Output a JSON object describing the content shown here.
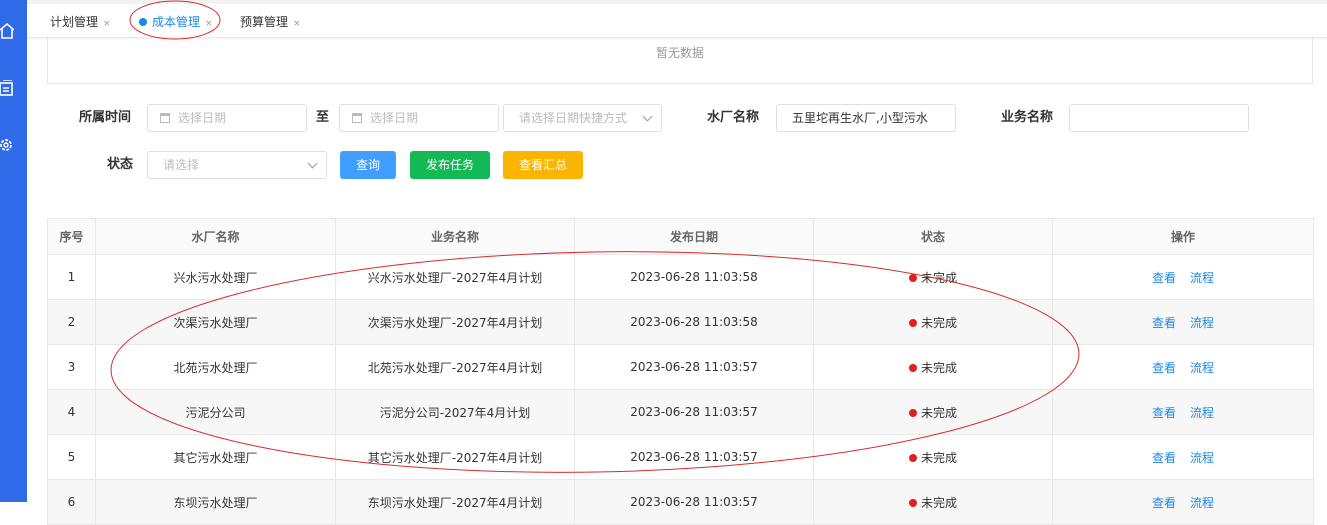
{
  "tabs": [
    {
      "label": "计划管理",
      "active": false
    },
    {
      "label": "成本管理",
      "active": true
    },
    {
      "label": "预算管理",
      "active": false
    }
  ],
  "tab_close_glyph": "×",
  "empty_text": "暂无数据",
  "filters": {
    "time_label": "所属时间",
    "date_start_placeholder": "选择日期",
    "range_sep": "至",
    "date_end_placeholder": "选择日期",
    "quick_placeholder": "请选择日期快捷方式",
    "plant_label": "水厂名称",
    "plant_value": "五里坨再生水厂,小型污水",
    "business_label": "业务名称",
    "business_value": "",
    "status_label": "状态",
    "status_placeholder": "请选择"
  },
  "buttons": {
    "query": "查询",
    "publish": "发布任务",
    "summary": "查看汇总"
  },
  "colors": {
    "sidebar": "#2f6be8",
    "active_tab": "#1e88e5",
    "query_button": "#409eff",
    "publish_button": "#13b955",
    "summary_button": "#fbb400",
    "status_dot": "#e02020",
    "annotation": "#d62b2b"
  },
  "table": {
    "headers": [
      "序号",
      "水厂名称",
      "业务名称",
      "发布日期",
      "状态",
      "操作"
    ],
    "rows": [
      {
        "no": "1",
        "plant": "兴水污水处理厂",
        "business": "兴水污水处理厂-2027年4月计划",
        "date": "2023-06-28 11:03:58",
        "status": "未完成"
      },
      {
        "no": "2",
        "plant": "次渠污水处理厂",
        "business": "次渠污水处理厂-2027年4月计划",
        "date": "2023-06-28 11:03:58",
        "status": "未完成"
      },
      {
        "no": "3",
        "plant": "北苑污水处理厂",
        "business": "北苑污水处理厂-2027年4月计划",
        "date": "2023-06-28 11:03:57",
        "status": "未完成"
      },
      {
        "no": "4",
        "plant": "污泥分公司",
        "business": "污泥分公司-2027年4月计划",
        "date": "2023-06-28 11:03:57",
        "status": "未完成"
      },
      {
        "no": "5",
        "plant": "其它污水处理厂",
        "business": "其它污水处理厂-2027年4月计划",
        "date": "2023-06-28 11:03:57",
        "status": "未完成"
      },
      {
        "no": "6",
        "plant": "东坝污水处理厂",
        "business": "东坝污水处理厂-2027年4月计划",
        "date": "2023-06-28 11:03:57",
        "status": "未完成"
      }
    ],
    "actions": {
      "view": "查看",
      "flow": "流程"
    }
  },
  "icons": {
    "sidebar": [
      "home-icon",
      "building-icon",
      "gear-icon"
    ],
    "date": "calendar-icon",
    "dropdown": "chevron-down-icon"
  }
}
